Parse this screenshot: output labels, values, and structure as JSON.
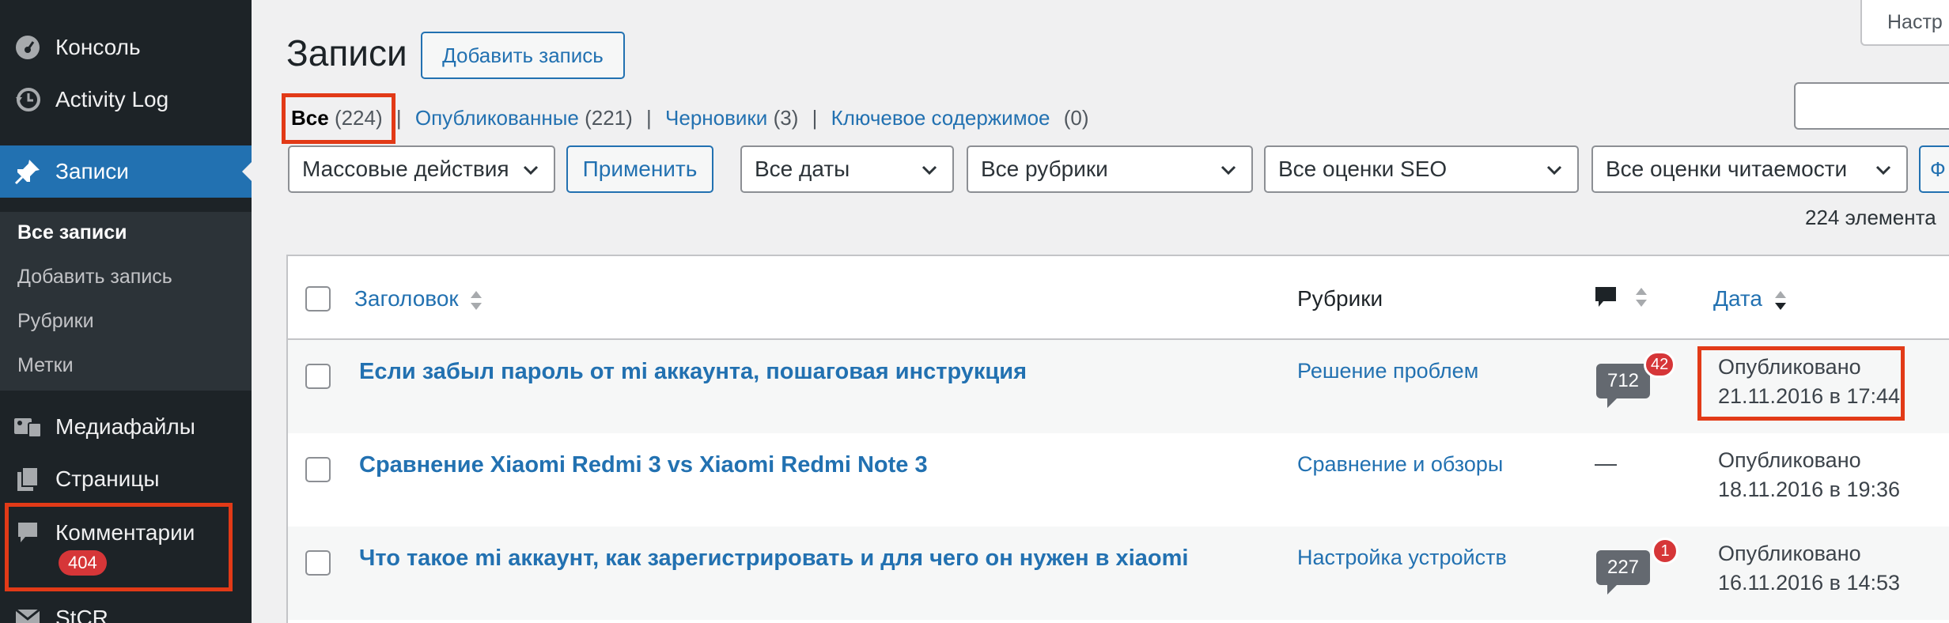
{
  "sidebar": {
    "items": [
      {
        "label": "Консоль",
        "icon": "dashboard-icon"
      },
      {
        "label": "Activity Log",
        "icon": "history-icon"
      },
      {
        "label": "Записи",
        "icon": "pin-icon"
      },
      {
        "label": "Медиафайлы",
        "icon": "media-icon"
      },
      {
        "label": "Страницы",
        "icon": "pages-icon"
      },
      {
        "label": "Комментарии",
        "icon": "comment-icon",
        "badge": "404"
      },
      {
        "label": "StCR",
        "icon": "mail-icon"
      }
    ],
    "submenu": [
      "Все записи",
      "Добавить запись",
      "Рубрики",
      "Метки"
    ]
  },
  "header": {
    "title": "Записи",
    "add_button": "Добавить запись",
    "screen_options": "Настр"
  },
  "status_links": [
    {
      "label": "Все",
      "count": "(224)"
    },
    {
      "label": "Опубликованные",
      "count": "(221)"
    },
    {
      "label": "Черновики",
      "count": "(3)"
    },
    {
      "label": "Ключевое содержимое",
      "count": "(0)"
    }
  ],
  "filters": {
    "bulk_actions": "Массовые действия",
    "apply": "Применить",
    "dates": "Все даты",
    "categories": "Все рубрики",
    "seo": "Все оценки SEO",
    "readability": "Все оценки читаемости",
    "filter_partial": "Ф"
  },
  "items_count": "224 элемента",
  "table": {
    "columns": {
      "title": "Заголовок",
      "categories": "Рубрики",
      "date": "Дата"
    },
    "rows": [
      {
        "title": "Если забыл пароль от mi аккаунта, пошаговая инструкция",
        "category": "Решение проблем",
        "comments": "712",
        "pending": "42",
        "status": "Опубликовано",
        "date": "21.11.2016 в 17:44"
      },
      {
        "title": "Сравнение Xiaomi Redmi 3 vs Xiaomi Redmi Note 3",
        "category": "Сравнение и обзоры",
        "comments": "—",
        "pending": "",
        "status": "Опубликовано",
        "date": "18.11.2016 в 19:36"
      },
      {
        "title": "Что такое mi аккаунт, как зарегистрировать и для чего он нужен в xiaomi",
        "category": "Настройка устройств",
        "comments": "227",
        "pending": "1",
        "status": "Опубликовано",
        "date": "16.11.2016 в 14:53"
      }
    ]
  },
  "colors": {
    "accent": "#2271b1",
    "sidebar": "#1d2327",
    "highlight": "#e23a17",
    "badge": "#d63638"
  }
}
